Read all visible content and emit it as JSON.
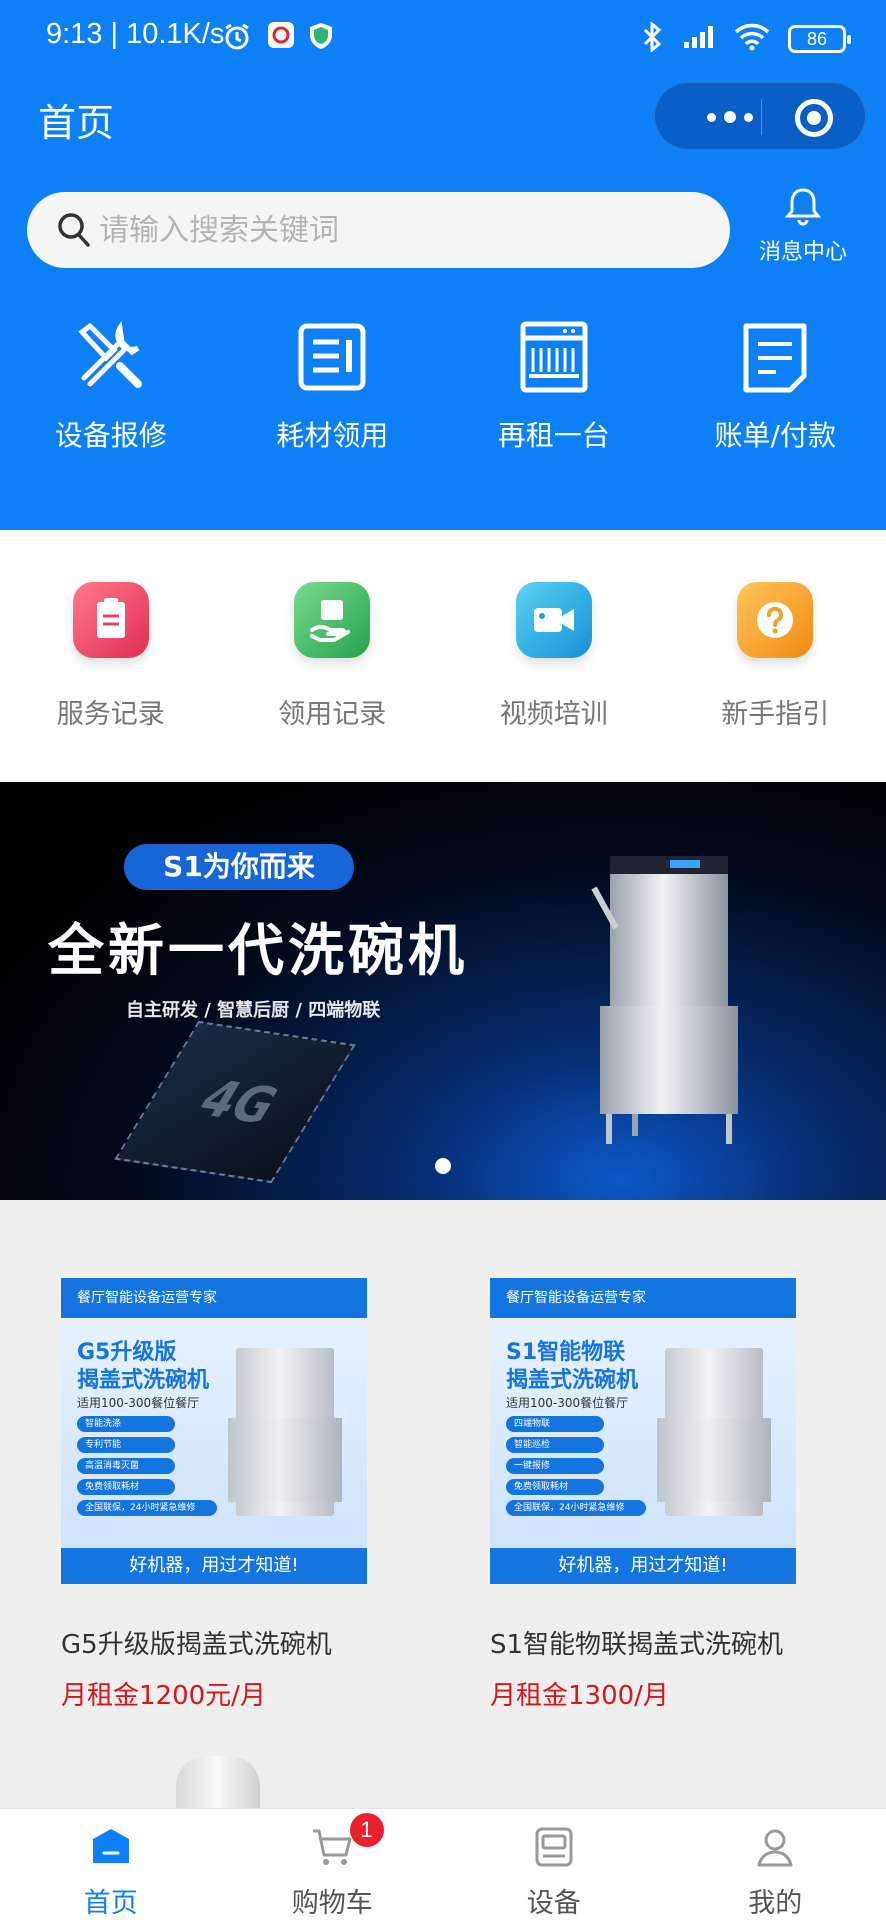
{
  "status_bar": {
    "time_speed": "9:13 | 10.1K/s",
    "battery": "86"
  },
  "header": {
    "title": "首页"
  },
  "search": {
    "placeholder": "请输入搜索关键词"
  },
  "message_center": {
    "label": "消息中心"
  },
  "quick_actions": [
    {
      "label": "设备报修",
      "icon": "wrench-screwdriver-icon"
    },
    {
      "label": "耗材领用",
      "icon": "document-pen-icon"
    },
    {
      "label": "再租一台",
      "icon": "dishwasher-icon"
    },
    {
      "label": "账单/付款",
      "icon": "bill-icon"
    }
  ],
  "services": [
    {
      "label": "服务记录",
      "icon": "clipboard-icon",
      "color": "#e8405f"
    },
    {
      "label": "领用记录",
      "icon": "hand-box-icon",
      "color": "#36b05c"
    },
    {
      "label": "视频培训",
      "icon": "video-camera-icon",
      "color": "#1aa2d8"
    },
    {
      "label": "新手指引",
      "icon": "question-icon",
      "color": "#f6a01e"
    }
  ],
  "banner": {
    "pill": "S1为你而来",
    "headline": "全新一代洗碗机",
    "subline": "自主研发 / 智慧后厨 / 四端物联",
    "chip_text": "4G",
    "active_slide": 1,
    "slide_count": 1
  },
  "products": [
    {
      "name": "G5升级版揭盖式洗碗机",
      "price": "月租金1200元/月",
      "image": {
        "brand_bar": "餐厅智能设备运营专家",
        "line1": "G5升级版",
        "line2": "揭盖式洗碗机",
        "suitable": "适用100-300餐位餐厅",
        "features": [
          "智能洗涤",
          "专利节能",
          "高温消毒灭菌",
          "免费领取耗材",
          "全国联保，24小时紧急维修"
        ],
        "slogan": "好机器，用过才知道!"
      }
    },
    {
      "name": "S1智能物联揭盖式洗碗机",
      "price": "月租金1300/月",
      "image": {
        "brand_bar": "餐厅智能设备运营专家",
        "line1": "S1智能物联",
        "line2": "揭盖式洗碗机",
        "suitable": "适用100-300餐位餐厅",
        "features": [
          "四端物联",
          "智能巡检",
          "一键报修",
          "免费领取耗材",
          "全国联保，24小时紧急维修"
        ],
        "slogan": "好机器，用过才知道!"
      }
    }
  ],
  "tabbar": [
    {
      "label": "首页",
      "icon": "home-icon",
      "active": true
    },
    {
      "label": "购物车",
      "icon": "cart-icon",
      "badge": "1"
    },
    {
      "label": "设备",
      "icon": "device-icon"
    },
    {
      "label": "我的",
      "icon": "user-icon"
    }
  ],
  "colors": {
    "primary": "#0e80f6",
    "price": "#d7151b",
    "badge": "#e8212c"
  }
}
